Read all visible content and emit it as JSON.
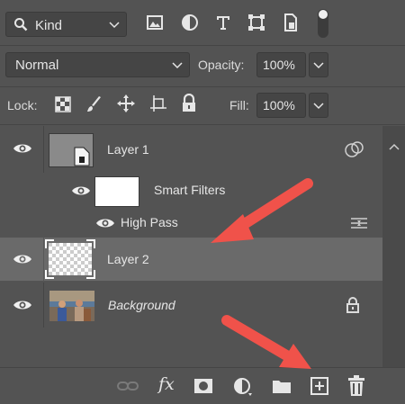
{
  "filter": {
    "kind_label": "Kind",
    "icons": [
      "image-filter-icon",
      "adjustment-filter-icon",
      "type-filter-icon",
      "shape-filter-icon",
      "smart-object-filter-icon",
      "filter-toggle-icon"
    ]
  },
  "blend": {
    "mode": "Normal",
    "opacity_label": "Opacity:",
    "opacity_value": "100%"
  },
  "lock": {
    "label": "Lock:",
    "fill_label": "Fill:",
    "fill_value": "100%",
    "icons": [
      "lock-transparent-pixels-icon",
      "lock-image-pixels-icon",
      "lock-position-icon",
      "lock-artboard-icon",
      "lock-all-icon"
    ]
  },
  "layers": [
    {
      "name": "Layer 1",
      "type": "smart-object",
      "visible": true,
      "selected": false
    },
    {
      "name": "Smart Filters",
      "type": "smart-filters",
      "visible": true
    },
    {
      "name": "High Pass",
      "type": "filter",
      "visible": true
    },
    {
      "name": "Layer 2",
      "type": "pixel",
      "visible": true,
      "selected": true
    },
    {
      "name": "Background",
      "type": "background",
      "visible": true,
      "locked": true,
      "italic": true
    }
  ],
  "bottom_toolbar": [
    "link-layers-icon",
    "fx-icon",
    "add-mask-icon",
    "adjustment-layer-icon",
    "new-group-icon",
    "new-layer-icon",
    "delete-layer-icon"
  ],
  "fx_label": "fx",
  "colors": {
    "panel_bg": "#535353",
    "selected_row": "#6a6a6a",
    "arrow": "#f0524a"
  }
}
